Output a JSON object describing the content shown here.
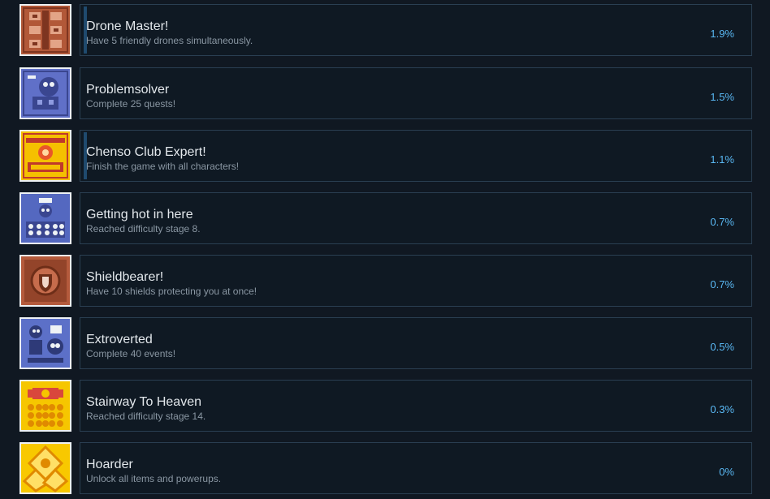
{
  "achievements": [
    {
      "title": "Drone Master!",
      "description": "Have 5 friendly drones simultaneously.",
      "percent": "1.9%",
      "icon": "drone-icon",
      "icon_bg": "#b25838"
    },
    {
      "title": "Problemsolver",
      "description": "Complete 25 quests!",
      "percent": "1.5%",
      "icon": "robot-icon",
      "icon_bg": "#6070c8"
    },
    {
      "title": "Chenso Club Expert!",
      "description": "Finish the game with all characters!",
      "percent": "1.1%",
      "icon": "chenso-badge-icon",
      "icon_bg": "#f5c000"
    },
    {
      "title": "Getting hot in here",
      "description": "Reached difficulty stage 8.",
      "percent": "0.7%",
      "icon": "difficulty-skulls-icon",
      "icon_bg": "#5468c0"
    },
    {
      "title": "Shieldbearer!",
      "description": "Have 10 shields protecting you at once!",
      "percent": "0.7%",
      "icon": "shield-icon",
      "icon_bg": "#b45a3c"
    },
    {
      "title": "Extroverted",
      "description": "Complete 40 events!",
      "percent": "0.5%",
      "icon": "characters-icon",
      "icon_bg": "#5c70c8"
    },
    {
      "title": "Stairway To Heaven",
      "description": "Reached difficulty stage 14.",
      "percent": "0.3%",
      "icon": "skull-pile-icon",
      "icon_bg": "#f6c600"
    },
    {
      "title": "Hoarder",
      "description": "Unlock all items and powerups.",
      "percent": "0%",
      "icon": "treasure-icon",
      "icon_bg": "#f8c800"
    }
  ]
}
